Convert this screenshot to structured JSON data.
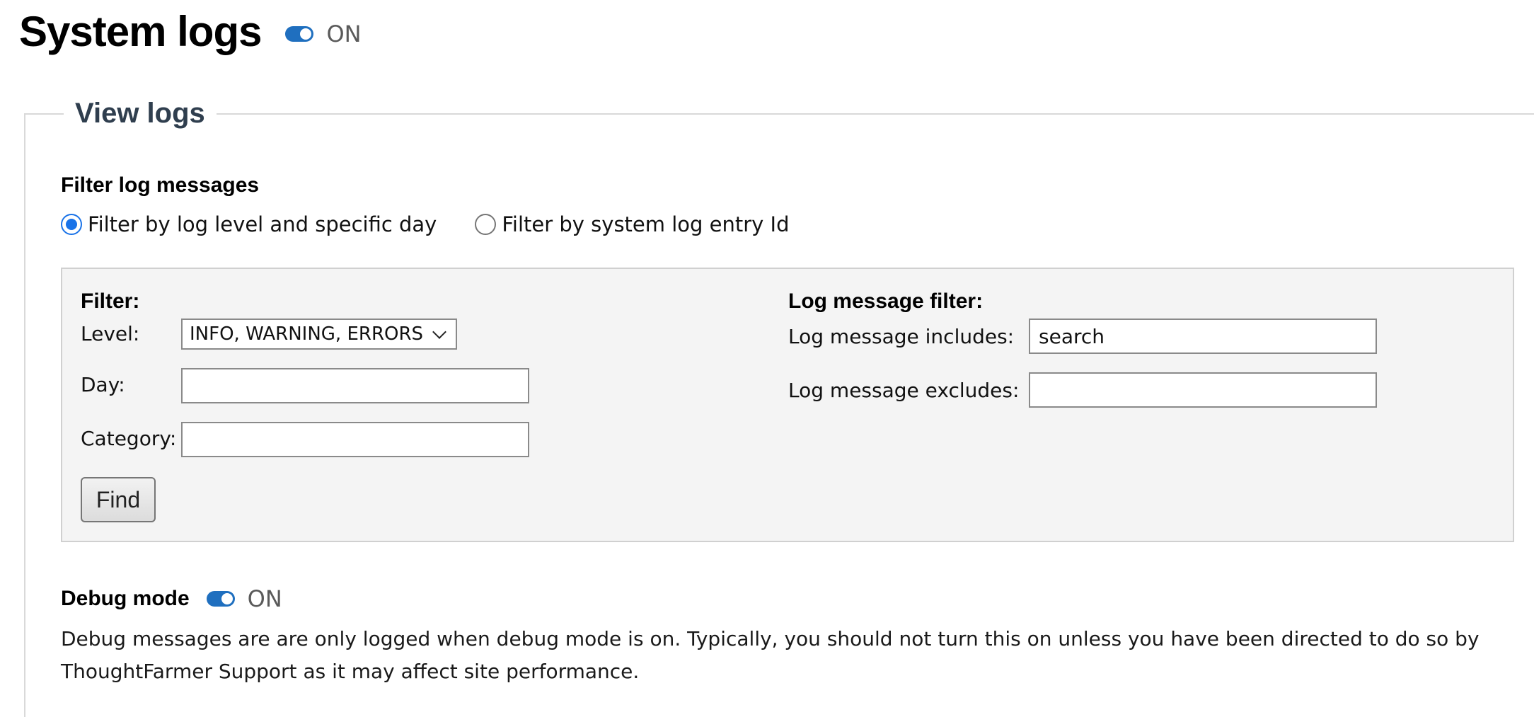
{
  "header": {
    "title": "System logs",
    "toggle": {
      "state_label": "ON",
      "on": true
    }
  },
  "view_logs": {
    "legend": "View logs",
    "filter_section": {
      "heading": "Filter log messages",
      "radios": [
        {
          "label": "Filter by log level and specific day",
          "checked": true
        },
        {
          "label": "Filter by system log entry Id",
          "checked": false
        }
      ]
    },
    "panel": {
      "left": {
        "heading": "Filter:",
        "level_label": "Level:",
        "level_value": "INFO, WARNING, ERRORS",
        "day_label": "Day:",
        "day_value": "",
        "category_label": "Category:",
        "category_value": ""
      },
      "right": {
        "heading": "Log message filter:",
        "includes_label": "Log message includes:",
        "includes_value": "search",
        "excludes_label": "Log message excludes:",
        "excludes_value": ""
      },
      "find_label": "Find"
    },
    "debug": {
      "label": "Debug mode",
      "state_label": "ON",
      "on": true,
      "description": "Debug messages are are only logged when debug mode is on. Typically, you should not turn this on unless you have been directed to do so by ThoughtFarmer Support as it may affect site performance."
    }
  },
  "colors": {
    "toggle_on": "#1f6fbf",
    "radio_checked": "#1a73e8",
    "legend_text": "#2f3e4e",
    "panel_bg": "#f4f4f4"
  }
}
